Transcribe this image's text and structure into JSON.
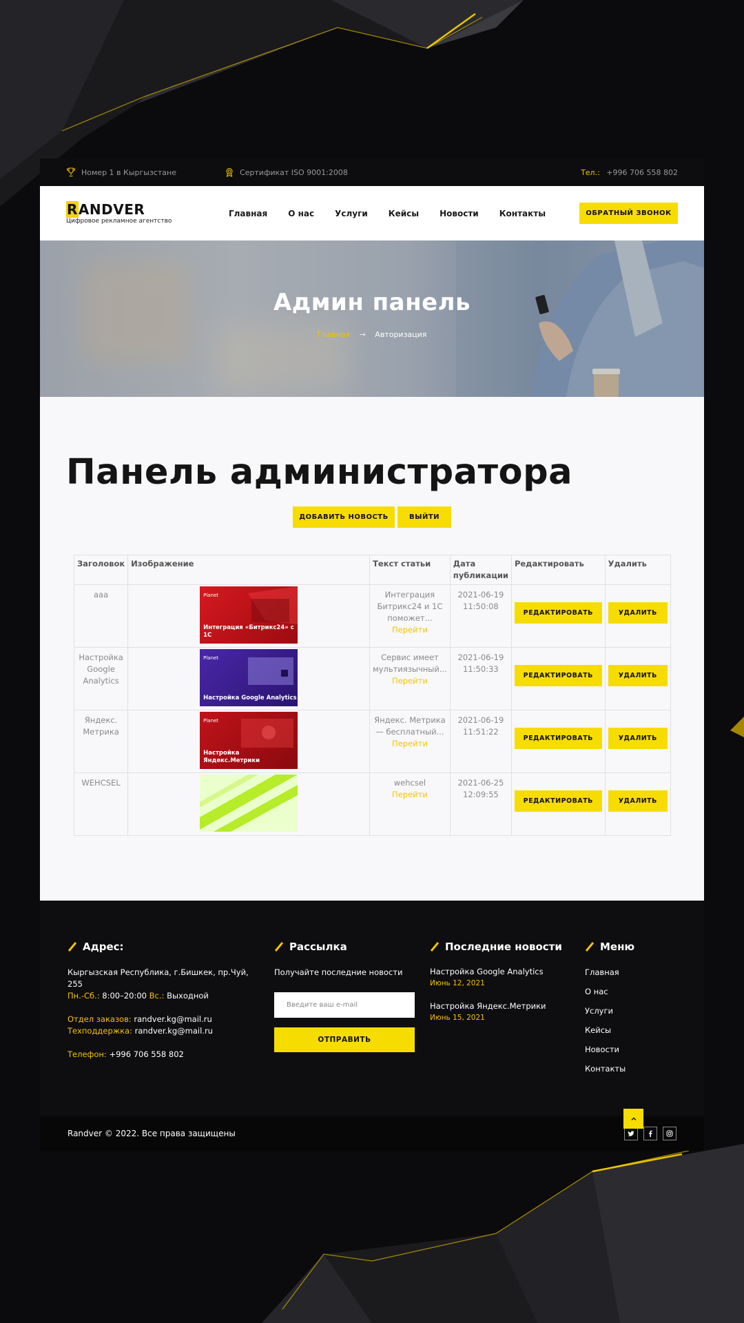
{
  "topbar": {
    "award_text": "Номер 1 в Кыргызстане",
    "cert_text": "Сертификат ISO 9001:2008",
    "phone_label": "Тел.:",
    "phone": "+996 706 558 802"
  },
  "header": {
    "logo_first": "R",
    "logo_rest": "ANDVER",
    "logo_tagline": "Цифровое рекламное агентство",
    "nav": [
      "Главная",
      "О нас",
      "Услуги",
      "Кейсы",
      "Новости",
      "Контакты"
    ],
    "callback_label": "ОБРАТНЫЙ ЗВОНОК"
  },
  "hero": {
    "title": "Админ панель",
    "crumb_home": "Главная",
    "crumb_sep": "→",
    "crumb_current": "Авторизация"
  },
  "main": {
    "title": "Панель администратора",
    "add_news_label": "ДОБАВИТЬ НОВОСТЬ",
    "logout_label": "ВЫЙТИ",
    "columns": [
      "Заголовок",
      "Изображение",
      "Текст статьи",
      "Дата публикации",
      "Редактировать",
      "Удалить"
    ],
    "go_label": "Перейти",
    "edit_label": "РЕДАКТИРОВАТЬ",
    "delete_label": "УДАЛИТЬ",
    "rows": [
      {
        "title": "ааа",
        "text": "Интеграция Битрикс24 и 1С поможет...",
        "date": "2021-06-19 11:50:08",
        "thumb_brand": "Planet",
        "thumb_caption": "Интеграция «Битрикс24» с 1С",
        "thumb_color": "#c8141a"
      },
      {
        "title": "Настройка Google Analytics",
        "text": "Сервис имеет мультиязычный...",
        "date": "2021-06-19 11:50:33",
        "thumb_brand": "Planet",
        "thumb_caption": "Настройка Google Analytics",
        "thumb_color": "#3a1e8c"
      },
      {
        "title": "Яндекс. Метрика",
        "text": "Яндекс. Метрика — бесплатный...",
        "date": "2021-06-19 11:51:22",
        "thumb_brand": "Planet",
        "thumb_caption": "Настройка Яндекс.Метрики",
        "thumb_color": "#b00d12"
      },
      {
        "title": "WEHCSEL",
        "text": "wehcsel",
        "date": "2021-06-25 12:09:55",
        "thumb_brand": "",
        "thumb_caption": "",
        "thumb_color": "#e9ffc8"
      }
    ]
  },
  "footer": {
    "address_title": "Адрес:",
    "address": "Кыргызская Республика, г.Бишкек, пр.Чуй, 255",
    "hours_label": "Пн.-Сб.:",
    "hours": "8:00–20:00",
    "sunday_label": "Вс.:",
    "sunday": "Выходной",
    "orders_label": "Отдел заказов:",
    "orders_email": "randver.kg@mail.ru",
    "support_label": "Техподдержка:",
    "support_email": "randver.kg@mail.ru",
    "phone_label": "Телефон:",
    "phone": "+996 706 558 802",
    "newsletter_title": "Рассылка",
    "newsletter_text": "Получайте последние новости",
    "email_placeholder": "Введите ваш e-mail",
    "send_label": "ОТПРАВИТЬ",
    "news_title": "Последние новости",
    "news": [
      {
        "title": "Настройка Google Analytics",
        "date": "Июнь 12, 2021"
      },
      {
        "title": "Настройка Яндекс.Метрики",
        "date": "Июнь 15, 2021"
      }
    ],
    "menu_title": "Меню",
    "menu": [
      "Главная",
      "О нас",
      "Услуги",
      "Кейсы",
      "Новости",
      "Контакты"
    ],
    "copyright": "Randver © 2022. Все права защищены"
  },
  "icons": {
    "award": "trophy-icon",
    "cert": "certificate-icon",
    "twitter": "twitter-icon",
    "facebook": "facebook-icon",
    "instagram": "instagram-icon",
    "to_top": "chevron-up-icon"
  },
  "colors": {
    "accent": "#f7dc00",
    "accent_text": "#f2c300",
    "dark": "#0e0e10",
    "content_bg": "#f8f8fa"
  }
}
